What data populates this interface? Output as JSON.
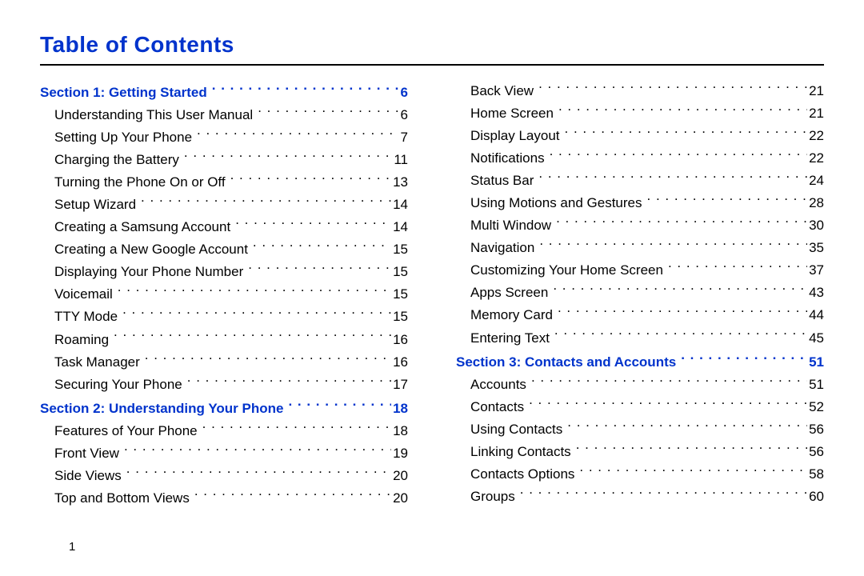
{
  "title": "Table of Contents",
  "page_number": "1",
  "columns": [
    [
      {
        "kind": "section",
        "label": "Section 1:  Getting Started",
        "page": "6"
      },
      {
        "kind": "item",
        "label": "Understanding This User Manual",
        "page": "6"
      },
      {
        "kind": "item",
        "label": "Setting Up Your Phone",
        "page": "7"
      },
      {
        "kind": "item",
        "label": "Charging the Battery",
        "page": "11"
      },
      {
        "kind": "item",
        "label": "Turning the Phone On or Off",
        "page": "13"
      },
      {
        "kind": "item",
        "label": "Setup Wizard",
        "page": "14"
      },
      {
        "kind": "item",
        "label": "Creating a Samsung Account",
        "page": "14"
      },
      {
        "kind": "item",
        "label": "Creating a New Google Account",
        "page": "15"
      },
      {
        "kind": "item",
        "label": "Displaying Your Phone Number",
        "page": "15"
      },
      {
        "kind": "item",
        "label": "Voicemail",
        "page": "15"
      },
      {
        "kind": "item",
        "label": "TTY Mode",
        "page": "15"
      },
      {
        "kind": "item",
        "label": "Roaming",
        "page": "16"
      },
      {
        "kind": "item",
        "label": "Task Manager",
        "page": "16"
      },
      {
        "kind": "item",
        "label": "Securing Your Phone",
        "page": "17"
      },
      {
        "kind": "section",
        "label": "Section 2:  Understanding Your Phone",
        "page": "18"
      },
      {
        "kind": "item",
        "label": "Features of Your Phone",
        "page": "18"
      },
      {
        "kind": "item",
        "label": "Front View",
        "page": "19"
      },
      {
        "kind": "item",
        "label": "Side Views",
        "page": "20"
      },
      {
        "kind": "item",
        "label": "Top and Bottom Views",
        "page": "20"
      }
    ],
    [
      {
        "kind": "item",
        "label": "Back View",
        "page": "21"
      },
      {
        "kind": "item",
        "label": "Home Screen",
        "page": "21"
      },
      {
        "kind": "item",
        "label": "Display Layout",
        "page": "22"
      },
      {
        "kind": "item",
        "label": "Notifications",
        "page": "22"
      },
      {
        "kind": "item",
        "label": "Status Bar",
        "page": "24"
      },
      {
        "kind": "item",
        "label": "Using Motions and Gestures",
        "page": "28"
      },
      {
        "kind": "item",
        "label": "Multi Window",
        "page": "30"
      },
      {
        "kind": "item",
        "label": "Navigation",
        "page": "35"
      },
      {
        "kind": "item",
        "label": "Customizing Your Home Screen",
        "page": "37"
      },
      {
        "kind": "item",
        "label": "Apps Screen",
        "page": "43"
      },
      {
        "kind": "item",
        "label": "Memory Card",
        "page": "44"
      },
      {
        "kind": "item",
        "label": "Entering Text",
        "page": "45"
      },
      {
        "kind": "section",
        "label": "Section 3:  Contacts and Accounts",
        "page": "51"
      },
      {
        "kind": "item",
        "label": "Accounts",
        "page": "51"
      },
      {
        "kind": "item",
        "label": "Contacts",
        "page": "52"
      },
      {
        "kind": "item",
        "label": "Using Contacts",
        "page": "56"
      },
      {
        "kind": "item",
        "label": "Linking Contacts",
        "page": "56"
      },
      {
        "kind": "item",
        "label": "Contacts Options",
        "page": "58"
      },
      {
        "kind": "item",
        "label": "Groups",
        "page": "60"
      }
    ]
  ]
}
